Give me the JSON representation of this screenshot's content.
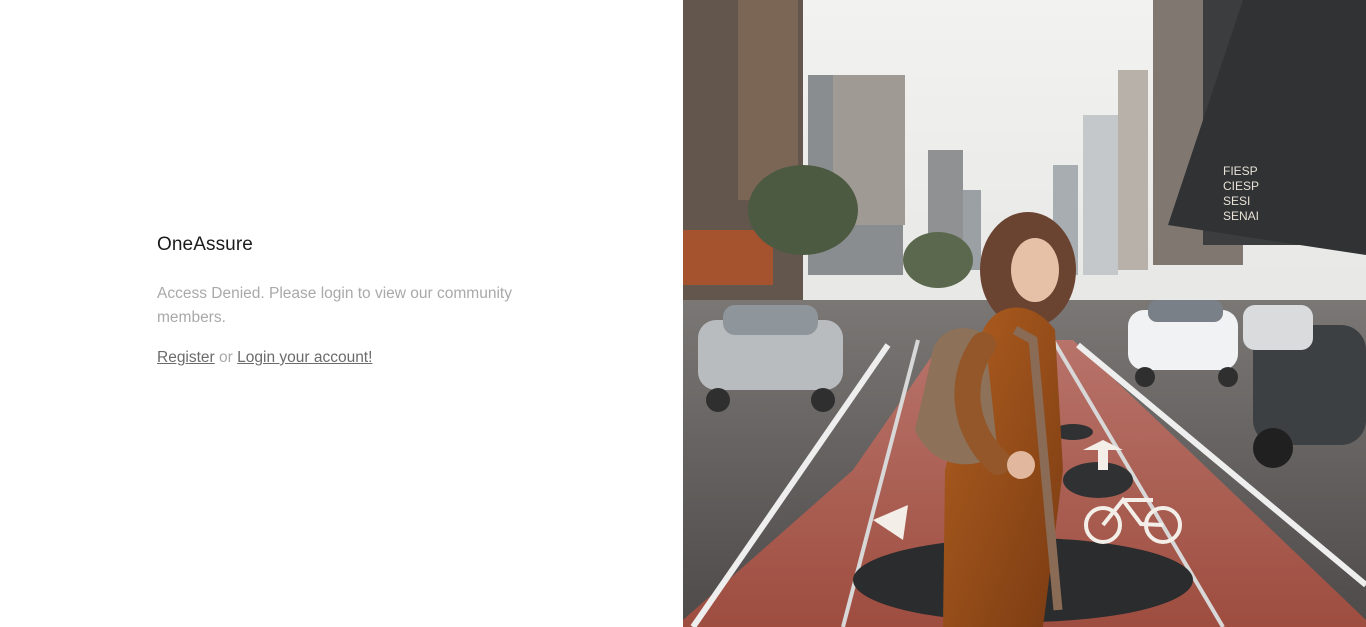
{
  "brand": {
    "name": "OneAssure"
  },
  "message": {
    "text": "Access Denied. Please login to view our community members."
  },
  "actions": {
    "register_label": "Register",
    "separator": "or",
    "login_label": "Login your account!"
  },
  "hero_image": {
    "description_icon": "city-street-woman-photo",
    "road_text": "FIESP CIESP SESI SENAI"
  }
}
